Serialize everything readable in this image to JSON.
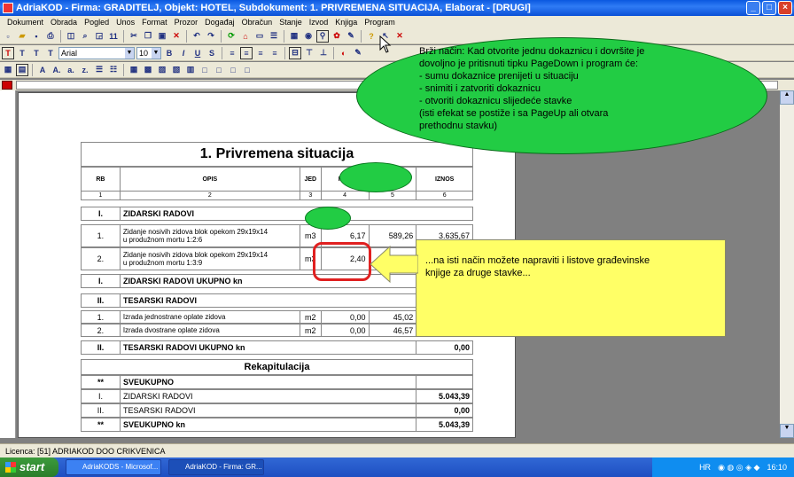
{
  "window": {
    "title": "AdriaKOD - Firma: GRADITELJ,  Objekt: HOTEL,  Subdokument: 1. PRIVREMENA SITUACIJA,  Elaborat - [DRUGI]"
  },
  "menu": [
    "Dokument",
    "Obrada",
    "Pogled",
    "Unos",
    "Format",
    "Prozor",
    "Događaj",
    "Obračun",
    "Stanje",
    "Izvod",
    "Knjiga",
    "Program"
  ],
  "format_bar": {
    "font": "Arial",
    "size": "10"
  },
  "document": {
    "title": "1. Privremena situacija",
    "headers": [
      "RB",
      "OPIS",
      "JED",
      "KOL",
      "",
      "IZNOS"
    ],
    "col_numbers": [
      "1",
      "2",
      "3",
      "4",
      "5",
      "6"
    ],
    "sections": [
      {
        "rb": "I.",
        "name": "ZIDARSKI RADOVI"
      },
      {
        "rb": "II.",
        "name": "TESARSKI RADOVI"
      }
    ],
    "rows": [
      {
        "rb": "1.",
        "opis1": "Zidanje nosivih zidova blok opekom 29x19x14",
        "opis2": "u produžnom mortu 1:2:6",
        "jed": "m3",
        "kol": "6,17",
        "cijena": "589,26",
        "iznos": "3.635,67"
      },
      {
        "rb": "2.",
        "opis1": "Zidanje nosivih zidova blok opekom 29x19x14",
        "opis2": "u produžnom mortu 1:3:9",
        "jed": "m3",
        "kol": "2,40",
        "cijena": "",
        "iznos": ""
      },
      {
        "rb": "1.",
        "opis1": "Izrada jednostrane oplate zidova",
        "jed": "m2",
        "kol": "0,00",
        "cijena": "45,02",
        "iznos": ""
      },
      {
        "rb": "2.",
        "opis1": "Izrada dvostrane oplate zidova",
        "jed": "m2",
        "kol": "0,00",
        "cijena": "46,57",
        "iznos": ""
      }
    ],
    "subtotals": [
      {
        "rb": "I.",
        "name": "ZIDARSKI RADOVI UKUPNO kn",
        "iznos": ""
      },
      {
        "rb": "II.",
        "name": "TESARSKI RADOVI UKUPNO kn",
        "iznos": "0,00"
      }
    ],
    "recap": {
      "title": "Rekapitulacija",
      "rows": [
        {
          "rb": "**",
          "name": "SVEUKUPNO",
          "iznos": "",
          "bold": true
        },
        {
          "rb": "I.",
          "name": "ZIDARSKI RADOVI",
          "iznos": "5.043,39"
        },
        {
          "rb": "II.",
          "name": "TESARSKI RADOVI",
          "iznos": "0,00"
        },
        {
          "rb": "**",
          "name": "SVEUKUPNO kn",
          "iznos": "5.043,39",
          "bold": true
        }
      ]
    }
  },
  "callout_green": {
    "lines": [
      "Brži način: Kad otvorite jednu dokaznicu i dovršite je",
      "dovoljno je pritisnuti tipku PageDown i program će:",
      "- sumu dokaznice prenijeti u situaciju",
      "- snimiti i zatvoriti dokaznicu",
      "- otvoriti dokaznicu slijedeće stavke",
      "(isti efekat se postiže i sa PageUp ali otvara",
      "prethodnu stavku)"
    ]
  },
  "callout_yellow": {
    "lines": [
      "...na isti način možete napraviti i listove građevinske",
      "knjige za druge stavke..."
    ]
  },
  "status": {
    "licence": "Licenca:  [51] ADRIAKOD DOO CRIKVENICA"
  },
  "taskbar": {
    "start": "start",
    "items": [
      "AdriaKODS - Microsof...",
      "AdriaKOD - Firma: GR..."
    ],
    "lang": "HR",
    "clock": "16:10"
  },
  "colors": {
    "titlebar": "#0a58e0",
    "callout_green": "#22cc44",
    "callout_yellow": "#ffff66",
    "highlight_red": "#e02020"
  }
}
